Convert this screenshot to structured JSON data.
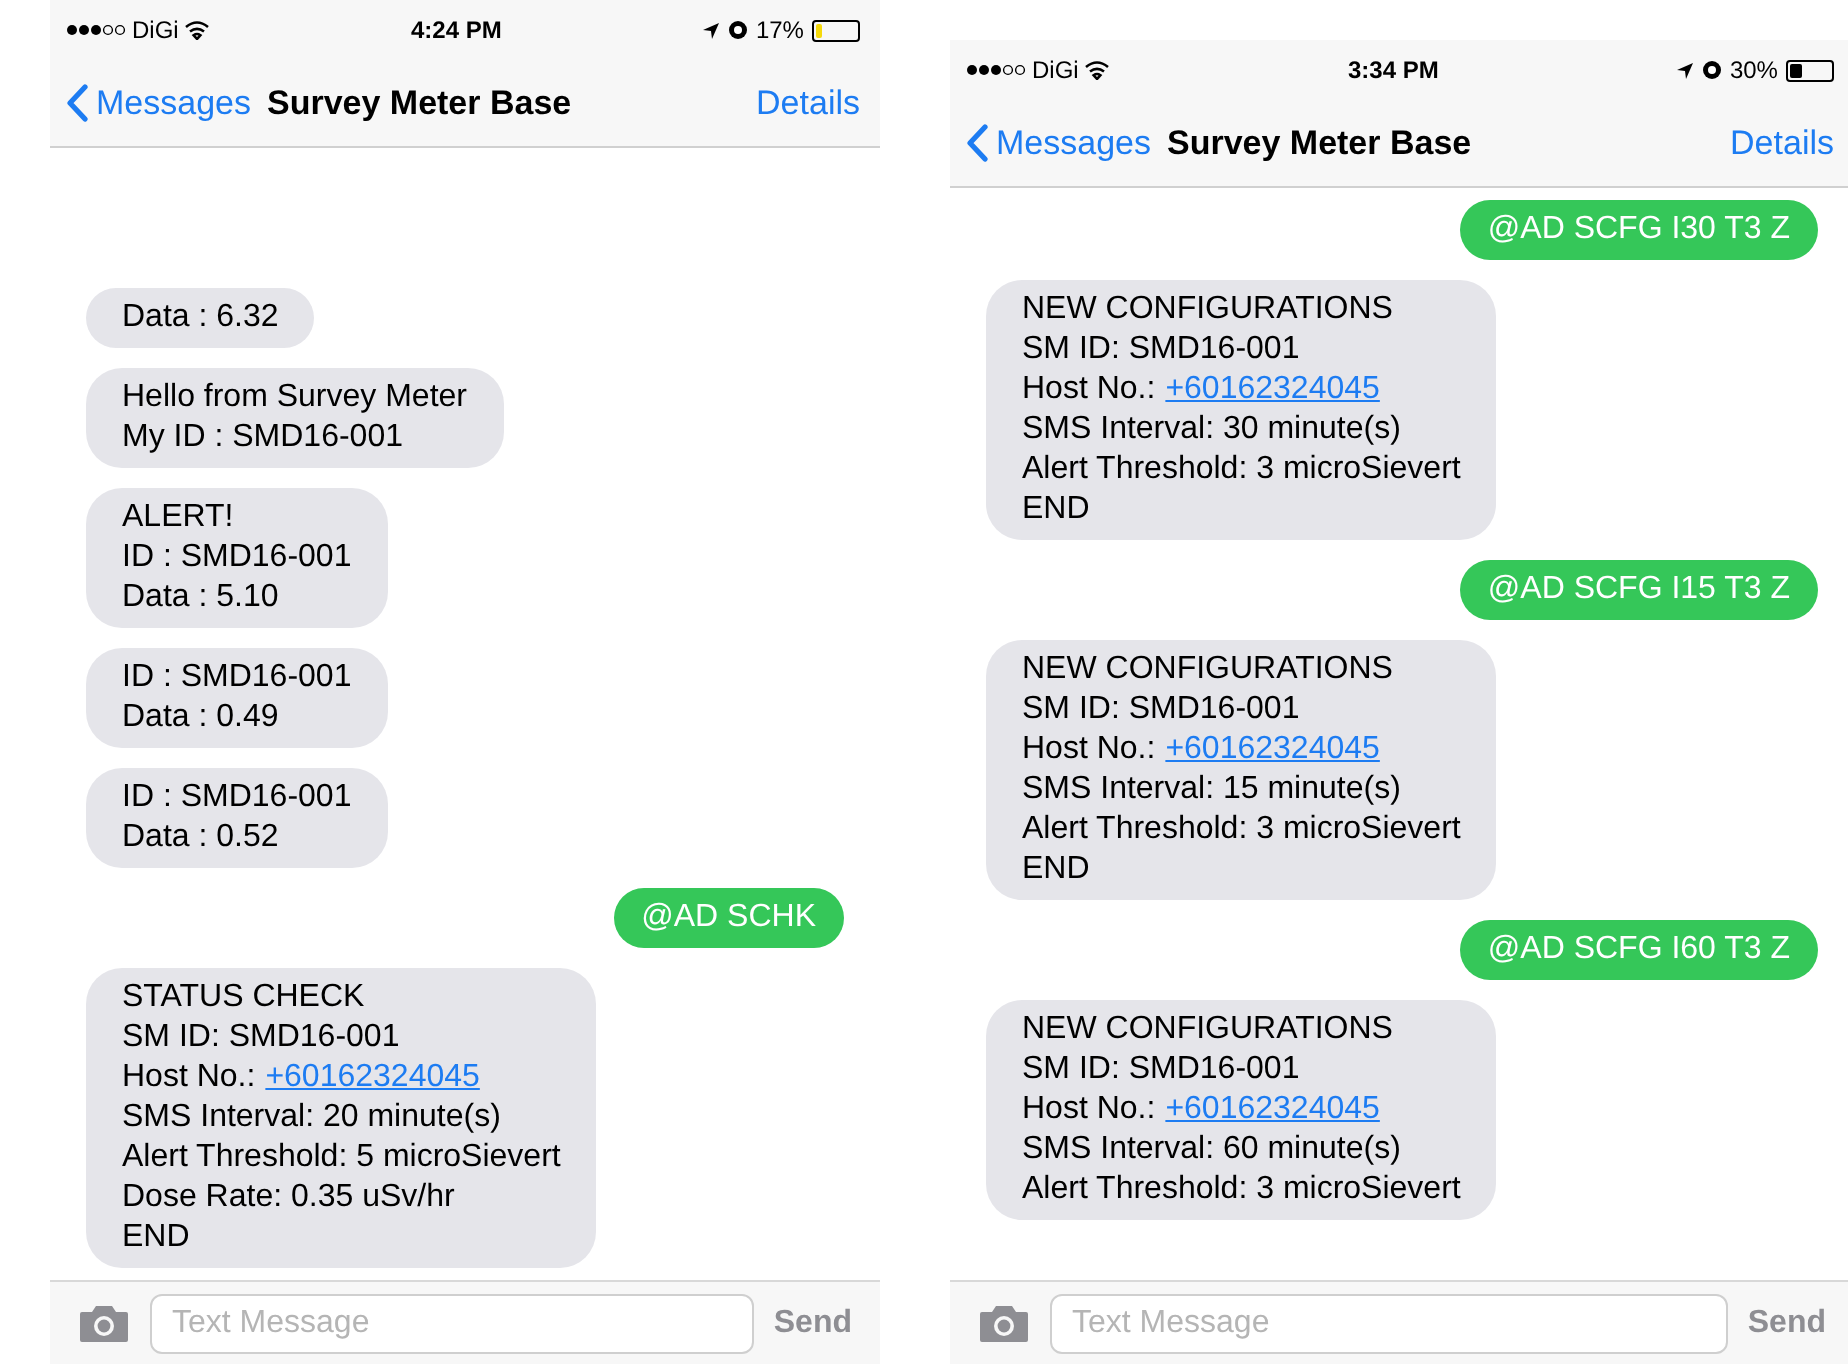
{
  "phones": [
    {
      "status_bar": {
        "carrier": "DiGi",
        "time": "4:24 PM",
        "battery_percent": "17%",
        "battery": {
          "level": 0.17
        }
      },
      "nav": {
        "back": "Messages",
        "title": "Survey Meter Base",
        "action": "Details"
      },
      "messages": [
        {
          "kind": "received",
          "lines": [
            {
              "text": "Data : 6.32"
            }
          ]
        },
        {
          "kind": "received",
          "lines": [
            {
              "text": "Hello from Survey Meter"
            },
            {
              "text": "My ID : SMD16-001"
            }
          ]
        },
        {
          "kind": "received",
          "lines": [
            {
              "text": "ALERT!"
            },
            {
              "text": "ID : SMD16-001"
            },
            {
              "text": "Data : 5.10"
            }
          ]
        },
        {
          "kind": "received",
          "lines": [
            {
              "text": "ID : SMD16-001"
            },
            {
              "text": "Data : 0.49"
            }
          ]
        },
        {
          "kind": "received",
          "lines": [
            {
              "text": "ID : SMD16-001"
            },
            {
              "text": "Data : 0.52"
            }
          ]
        },
        {
          "kind": "sent",
          "lines": [
            {
              "text": "@AD SCHK"
            }
          ]
        },
        {
          "kind": "received",
          "lines": [
            {
              "text": "STATUS CHECK"
            },
            {
              "text": "SM ID: SMD16-001"
            },
            {
              "text": "Host No.:",
              "link": "+60162324045"
            },
            {
              "text": "SMS Interval: 20 minute(s)"
            },
            {
              "text": "Alert Threshold: 5 microSievert"
            },
            {
              "text": "Dose Rate: 0.35 uSv/hr"
            },
            {
              "text": "END"
            }
          ]
        }
      ],
      "composer": {
        "placeholder": "Text Message",
        "send": "Send"
      }
    },
    {
      "status_bar": {
        "carrier": "DiGi",
        "time": "3:34 PM",
        "battery_percent": "30%",
        "battery": {
          "level": 0.3
        }
      },
      "nav": {
        "back": "Messages",
        "title": "Survey Meter Base",
        "action": "Details"
      },
      "messages": [
        {
          "kind": "sent",
          "lines": [
            {
              "text": "@AD SCFG I30 T3 Z"
            }
          ]
        },
        {
          "kind": "received",
          "lines": [
            {
              "text": "NEW CONFIGURATIONS"
            },
            {
              "text": "SM ID: SMD16-001"
            },
            {
              "text": "Host No.:",
              "link": "+60162324045"
            },
            {
              "text": "SMS Interval: 30 minute(s)"
            },
            {
              "text": "Alert Threshold: 3 microSievert"
            },
            {
              "text": "END"
            }
          ]
        },
        {
          "kind": "sent",
          "lines": [
            {
              "text": "@AD SCFG I15 T3 Z"
            }
          ]
        },
        {
          "kind": "received",
          "lines": [
            {
              "text": "NEW CONFIGURATIONS"
            },
            {
              "text": "SM ID: SMD16-001"
            },
            {
              "text": "Host No.:",
              "link": "+60162324045"
            },
            {
              "text": "SMS Interval: 15 minute(s)"
            },
            {
              "text": "Alert Threshold: 3 microSievert"
            },
            {
              "text": "END"
            }
          ]
        },
        {
          "kind": "sent",
          "lines": [
            {
              "text": "@AD SCFG I60 T3 Z"
            }
          ]
        },
        {
          "kind": "received",
          "lines": [
            {
              "text": "NEW CONFIGURATIONS"
            },
            {
              "text": "SM ID: SMD16-001"
            },
            {
              "text": "Host No.:",
              "link": "+60162324045"
            },
            {
              "text": "SMS Interval: 60 minute(s)"
            },
            {
              "text": "Alert Threshold: 3 microSievert"
            }
          ]
        }
      ],
      "composer": {
        "placeholder": "Text Message",
        "send": "Send"
      }
    }
  ]
}
